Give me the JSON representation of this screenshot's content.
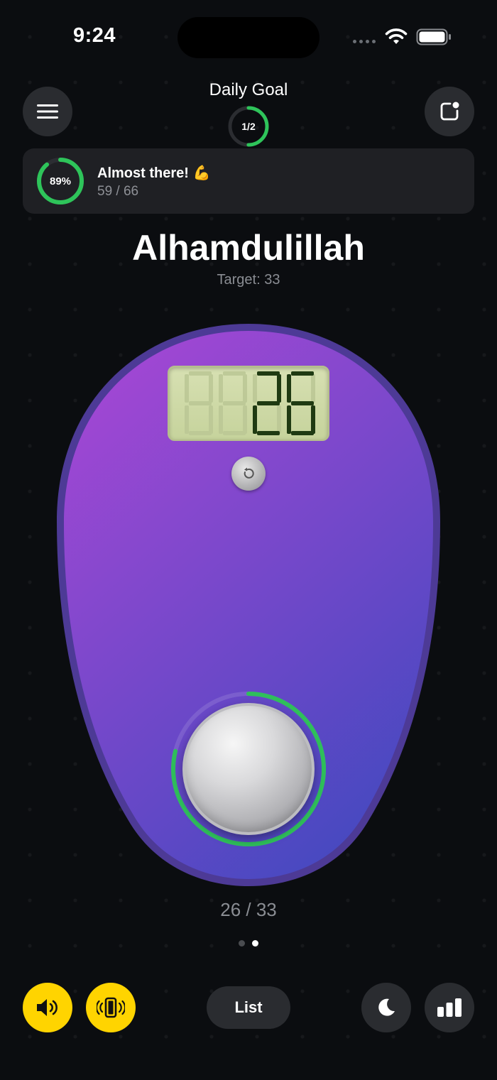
{
  "status_bar": {
    "time": "9:24"
  },
  "header": {
    "title": "Daily Goal",
    "goal_progress_text": "1/2",
    "goal_progress_fraction": 0.5
  },
  "progress_card": {
    "percent_text": "89%",
    "percent_value": 0.89,
    "title": "Almost there! 💪",
    "subtitle": "59 / 66"
  },
  "dhikr": {
    "name": "Alhamdulillah",
    "target_text": "Target: 33"
  },
  "counter": {
    "lcd_value": "26",
    "count_text": "26 / 33",
    "progress_fraction": 0.788
  },
  "bottom_bar": {
    "list_label": "List"
  },
  "pagination": {
    "count": 2,
    "active": 1
  },
  "colors": {
    "accent_green": "#2ec45a",
    "accent_yellow": "#ffd400",
    "device_top": "#a347d4",
    "device_bottom": "#4249bf",
    "lcd_digit": "#1f3a12"
  },
  "icons": {
    "menu": "hamburger-icon",
    "edit": "note-edit-icon",
    "reset": "reset-icon",
    "sound": "speaker-icon",
    "vibrate": "vibrate-icon",
    "theme": "moon-icon",
    "stats": "bar-chart-icon"
  }
}
